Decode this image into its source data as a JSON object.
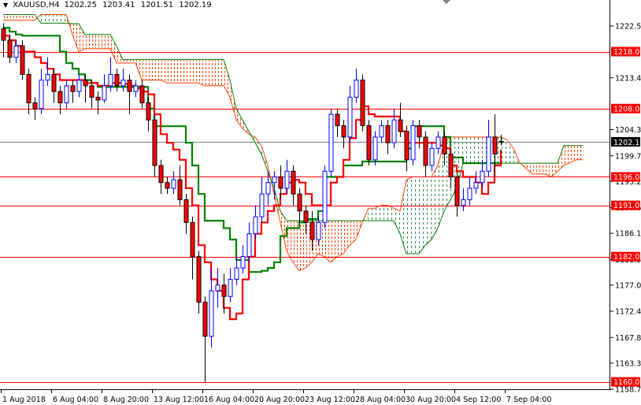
{
  "header": {
    "symbol": "XAUUSD,H4",
    "open": "1202.25",
    "high": "1203.41",
    "low": "1201.51",
    "close": "1202.19"
  },
  "colors": {
    "bull": "#0000ff",
    "bear": "#ff0000",
    "tenkan": "#ff0000",
    "kijun": "#008000",
    "cloud_bear": "#ff4500",
    "cloud_bull": "#2e8b57",
    "level_line": "#ff0000",
    "price_line": "#808080"
  },
  "chart_data": {
    "type": "candlestick",
    "title": "XAUUSD,H4",
    "ylim": [
      1157.0,
      1227.0
    ],
    "y_ticks": [
      "1222.50",
      "1213.40",
      "1204.30",
      "1199.70",
      "1195.20",
      "1190.60",
      "1186.10",
      "1181.50",
      "1177.00",
      "1172.40",
      "1167.80",
      "1163.30",
      "1158.70"
    ],
    "x_ticks": [
      "1 Aug 2018",
      "6 Aug 04:00",
      "8 Aug 20:00",
      "13 Aug 12:00",
      "16 Aug 04:00",
      "20 Aug 20:00",
      "23 Aug 12:00",
      "28 Aug 04:00",
      "30 Aug 20:00",
      "4 Sep 12:00",
      "7 Sep 04:00"
    ],
    "x_tick_bars": [
      0,
      8,
      16,
      24,
      32,
      40,
      48,
      56,
      64,
      72,
      80
    ],
    "levels": [
      "1218.00",
      "1208.00",
      "1196.00",
      "1191.00",
      "1182.00",
      "1160.00"
    ],
    "current_price": "1202.19",
    "candles_ohlc": [
      [
        1222,
        1223,
        1217,
        1220
      ],
      [
        1220,
        1221,
        1216,
        1217
      ],
      [
        1217,
        1220,
        1216,
        1219
      ],
      [
        1219,
        1220,
        1213,
        1214
      ],
      [
        1214,
        1215,
        1207,
        1209
      ],
      [
        1209,
        1210,
        1206,
        1208
      ],
      [
        1208,
        1215,
        1207,
        1213
      ],
      [
        1213,
        1217,
        1212,
        1214
      ],
      [
        1214,
        1215,
        1209,
        1211
      ],
      [
        1211,
        1212,
        1207,
        1209
      ],
      [
        1209,
        1213,
        1208,
        1212
      ],
      [
        1212,
        1213,
        1209,
        1211
      ],
      [
        1211,
        1214,
        1210,
        1213
      ],
      [
        1213,
        1214,
        1209,
        1212
      ],
      [
        1212,
        1213,
        1208,
        1210
      ],
      [
        1210,
        1211,
        1207,
        1209.5
      ],
      [
        1209.5,
        1214,
        1209,
        1212
      ],
      [
        1212,
        1217,
        1211,
        1214
      ],
      [
        1214,
        1215,
        1211,
        1212
      ],
      [
        1212,
        1215,
        1211,
        1213
      ],
      [
        1213,
        1214,
        1207,
        1211
      ],
      [
        1211,
        1213,
        1210,
        1212
      ],
      [
        1212,
        1213,
        1208,
        1209
      ],
      [
        1209,
        1210,
        1204,
        1206
      ],
      [
        1206,
        1207,
        1196,
        1198
      ],
      [
        1198,
        1199,
        1193,
        1195
      ],
      [
        1195,
        1196,
        1193,
        1194
      ],
      [
        1194,
        1197,
        1193,
        1195.5
      ],
      [
        1195.5,
        1198,
        1191,
        1192
      ],
      [
        1192,
        1193,
        1186,
        1188
      ],
      [
        1188,
        1189,
        1178,
        1182
      ],
      [
        1182,
        1183,
        1172,
        1174
      ],
      [
        1174,
        1175,
        1160,
        1168
      ],
      [
        1168,
        1180,
        1166,
        1176
      ],
      [
        1176,
        1180,
        1173,
        1177
      ],
      [
        1177,
        1179,
        1172,
        1175
      ],
      [
        1175,
        1180,
        1174,
        1178
      ],
      [
        1178,
        1182,
        1177,
        1180
      ],
      [
        1180,
        1184,
        1179,
        1182
      ],
      [
        1182,
        1188,
        1181,
        1186
      ],
      [
        1186,
        1191,
        1185,
        1189
      ],
      [
        1189,
        1196,
        1188,
        1193
      ],
      [
        1193,
        1197,
        1191,
        1195
      ],
      [
        1195,
        1197,
        1192,
        1196
      ],
      [
        1196,
        1198,
        1192,
        1194
      ],
      [
        1194,
        1199,
        1193,
        1197
      ],
      [
        1197,
        1198,
        1191,
        1193
      ],
      [
        1193,
        1194,
        1188,
        1190
      ],
      [
        1190,
        1191,
        1186,
        1188
      ],
      [
        1188,
        1190,
        1183,
        1185
      ],
      [
        1185,
        1189,
        1184,
        1188
      ],
      [
        1188,
        1198,
        1187,
        1197
      ],
      [
        1197,
        1208,
        1196,
        1207
      ],
      [
        1207,
        1208,
        1203,
        1205
      ],
      [
        1205,
        1206,
        1201,
        1203
      ],
      [
        1203,
        1212,
        1202,
        1210
      ],
      [
        1210,
        1215,
        1209,
        1213
      ],
      [
        1213,
        1214,
        1204,
        1205
      ],
      [
        1205,
        1206,
        1198,
        1199
      ],
      [
        1199,
        1204,
        1198,
        1203
      ],
      [
        1203,
        1206,
        1202,
        1205
      ],
      [
        1205,
        1206,
        1200,
        1202
      ],
      [
        1202,
        1208,
        1201,
        1206
      ],
      [
        1206,
        1209,
        1203,
        1204
      ],
      [
        1204,
        1205,
        1197,
        1199
      ],
      [
        1199,
        1206,
        1198,
        1205
      ],
      [
        1205,
        1206,
        1201,
        1203
      ],
      [
        1203,
        1204,
        1196,
        1198
      ],
      [
        1198,
        1202,
        1197,
        1201
      ],
      [
        1201,
        1204,
        1200,
        1203
      ],
      [
        1203,
        1204,
        1198,
        1200
      ],
      [
        1200,
        1201,
        1194,
        1196
      ],
      [
        1196,
        1197,
        1189,
        1191
      ],
      [
        1191,
        1194,
        1190,
        1192
      ],
      [
        1192,
        1196,
        1191,
        1194
      ],
      [
        1194,
        1197,
        1193,
        1195
      ],
      [
        1195,
        1199,
        1194,
        1197
      ],
      [
        1197,
        1206,
        1196,
        1203
      ],
      [
        1203,
        1207,
        1196,
        1200
      ],
      [
        1202.25,
        1203.41,
        1201.51,
        1202.19
      ]
    ],
    "tenkan_sen": [
      1220.8,
      1220,
      1219,
      1218,
      1218,
      1217,
      1216,
      1215,
      1214,
      1213,
      1213,
      1213,
      1213,
      1212.5,
      1212.5,
      1212,
      1212,
      1212.5,
      1212.5,
      1212.3,
      1212,
      1211.5,
      1211,
      1210.5,
      1207,
      1203.5,
      1202,
      1200.8,
      1199,
      1194,
      1191,
      1184,
      1181,
      1178,
      1176,
      1173,
      1171,
      1172,
      1178,
      1182,
      1186,
      1188,
      1190,
      1191,
      1193,
      1195,
      1195.5,
      1195,
      1193,
      1191,
      1191,
      1191,
      1195,
      1196,
      1199,
      1202.8,
      1206,
      1208.4,
      1207,
      1206.6,
      1206.6,
      1206.6,
      1206.6,
      1204,
      1202,
      1202,
      1202,
      1202,
      1202,
      1201.5,
      1201,
      1198,
      1197,
      1196,
      1196,
      1195,
      1193,
      1195,
      1198,
      1200.8
    ],
    "kijun_sen": [
      1222.2,
      1221.5,
      1221,
      1220.8,
      1220.8,
      1220.8,
      1220.8,
      1220.8,
      1220.8,
      1218,
      1216,
      1215,
      1214,
      1213,
      1212.5,
      1211.8,
      1211.8,
      1211.8,
      1211.8,
      1211.8,
      1211.8,
      1211.8,
      1211.8,
      1208,
      1204.9,
      1204.9,
      1204.9,
      1204.9,
      1204.9,
      1202,
      1198,
      1193,
      1188.3,
      1188.3,
      1188.3,
      1187,
      1185,
      1181.4,
      1181.4,
      1179.3,
      1179.3,
      1179.5,
      1180,
      1181,
      1185.6,
      1187,
      1187,
      1188,
      1188.6,
      1188.6,
      1190,
      1196,
      1196,
      1196,
      1198,
      1198,
      1198,
      1198.7,
      1198.7,
      1198.7,
      1198.7,
      1198.7,
      1198.7,
      1198.7,
      1201,
      1204.9,
      1204.9,
      1204.9,
      1204.9,
      1204.9,
      1203,
      1199.4,
      1199.4,
      1198.4,
      1198.4,
      1198.4,
      1198.4,
      1198.4,
      1198.4,
      1198.4
    ],
    "senkou_span_a": [
      1223.5,
      1223.5,
      1223.5,
      1223.5,
      1223.5,
      1223.5,
      1224.5,
      1224.5,
      1224.5,
      1224.5,
      1224.5,
      1221,
      1218,
      1218.5,
      1218.5,
      1218.5,
      1218.5,
      1218.5,
      1216,
      1216,
      1216,
      1216,
      1213,
      1213,
      1213,
      1213,
      1212.5,
      1212.5,
      1212.5,
      1212.5,
      1212.5,
      1212.5,
      1212,
      1212,
      1212,
      1212,
      1210,
      1206,
      1204.5,
      1203.5,
      1203,
      1201.5,
      1198,
      1193,
      1188,
      1183,
      1181,
      1179.5,
      1180,
      1181,
      1182.5,
      1182,
      1181,
      1182,
      1182.5,
      1184,
      1185,
      1188,
      1190.5,
      1190.5,
      1191,
      1191,
      1190.5,
      1190,
      1195.5,
      1196,
      1196,
      1196,
      1196,
      1198,
      1202,
      1203,
      1203,
      1203,
      1203,
      1203,
      1203,
      1203,
      1203,
      1203,
      1202.5,
      1201,
      1198.5,
      1197.5,
      1196.5,
      1196.5,
      1196.5,
      1196,
      1197,
      1198,
      1198.5,
      1199,
      1199
    ],
    "senkou_span_b": [
      1224.5,
      1224.5,
      1224.5,
      1224.5,
      1224.5,
      1224.5,
      1223,
      1223,
      1223,
      1223,
      1223,
      1222.9,
      1222.9,
      1221,
      1221,
      1221,
      1221,
      1221,
      1219,
      1216.6,
      1216.6,
      1216.6,
      1216.6,
      1216.6,
      1216.6,
      1216.6,
      1216.6,
      1216.6,
      1216.6,
      1216.6,
      1216.6,
      1216.6,
      1216.6,
      1216.6,
      1216.6,
      1216.6,
      1213,
      1208,
      1206,
      1204,
      1202,
      1200,
      1197,
      1194,
      1190,
      1188.3,
      1188.3,
      1188.3,
      1188.3,
      1188.3,
      1188.3,
      1188.3,
      1188.3,
      1188.3,
      1188.3,
      1188.3,
      1188.3,
      1188.3,
      1188.3,
      1188.3,
      1188.3,
      1188.3,
      1188.3,
      1186,
      1182.5,
      1182.5,
      1182.5,
      1184,
      1185,
      1187,
      1190,
      1192,
      1194,
      1198.4,
      1198.4,
      1198.4,
      1198.4,
      1198.4,
      1198.4,
      1198.4,
      1198.4,
      1198.4,
      1198.4,
      1198.4,
      1198.4,
      1198.4,
      1198.4,
      1198.4,
      1198.4,
      1201.5,
      1201.5,
      1201.5,
      1201.5
    ]
  }
}
